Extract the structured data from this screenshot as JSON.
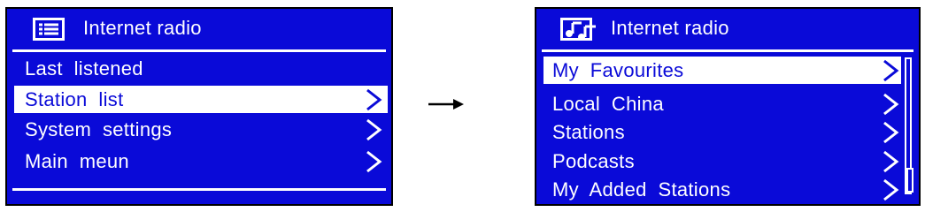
{
  "screen_left": {
    "title": "Internet radio",
    "header_icon": "list-icon",
    "items": [
      {
        "label": "Last  listened",
        "has_chevron": false,
        "selected": false
      },
      {
        "label": "Station  list",
        "has_chevron": true,
        "selected": true
      },
      {
        "label": "System  settings",
        "has_chevron": true,
        "selected": false
      },
      {
        "label": "Main  meun",
        "has_chevron": true,
        "selected": false
      }
    ]
  },
  "transition_icon": "right-arrow-icon",
  "screen_right": {
    "title": "Internet  radio",
    "header_icon": "music-notes-icon",
    "items": [
      {
        "label": "My  Favourites",
        "has_chevron": true,
        "selected": true
      },
      {
        "label": "Local  China",
        "has_chevron": true,
        "selected": false
      },
      {
        "label": "Stations",
        "has_chevron": true,
        "selected": false
      },
      {
        "label": "Podcasts",
        "has_chevron": true,
        "selected": false
      },
      {
        "label": "My  Added  Stations",
        "has_chevron": true,
        "selected": false
      }
    ]
  },
  "colors": {
    "screen_bg": "#0a0ad8",
    "text": "#ffffff",
    "page_bg": "#ffffff"
  }
}
